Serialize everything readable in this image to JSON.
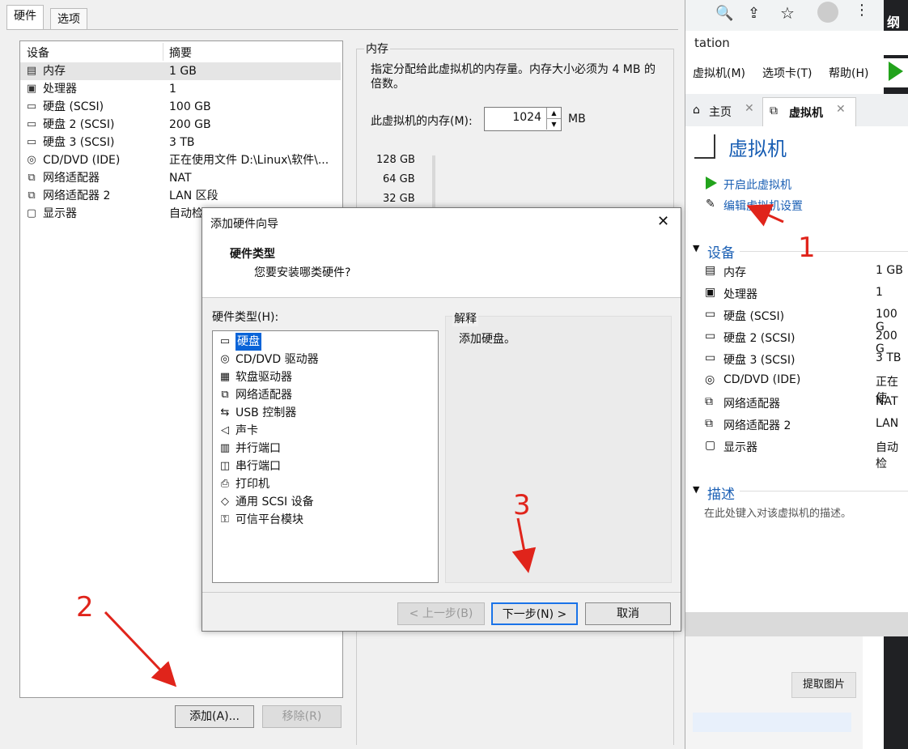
{
  "bg_window": {
    "title_fragment": "tation",
    "menu": [
      "虚拟机(M)",
      "选项卡(T)",
      "帮助(H)"
    ],
    "tabs": [
      {
        "label": "主页"
      },
      {
        "label": "虚拟机"
      }
    ],
    "vm_title": "虚拟机",
    "actions": [
      "开启此虚拟机",
      "编辑虚拟机设置"
    ],
    "devices_header": "设备",
    "devices": [
      {
        "name": "内存",
        "value": "1 GB"
      },
      {
        "name": "处理器",
        "value": "1"
      },
      {
        "name": "硬盘 (SCSI)",
        "value": "100 G"
      },
      {
        "name": "硬盘 2 (SCSI)",
        "value": "200 G"
      },
      {
        "name": "硬盘 3 (SCSI)",
        "value": "3 TB"
      },
      {
        "name": "CD/DVD (IDE)",
        "value": "正在使"
      },
      {
        "name": "网络适配器",
        "value": "NAT"
      },
      {
        "name": "网络适配器 2",
        "value": "LAN "
      },
      {
        "name": "显示器",
        "value": "自动检"
      }
    ],
    "desc_header": "描述",
    "desc_placeholder": "在此处键入对该虚拟机的描述。",
    "extract_button": "提取图片",
    "corner_text": "纲"
  },
  "settings": {
    "tabs": [
      "硬件",
      "选项"
    ],
    "columns": {
      "device": "设备",
      "summary": "摘要"
    },
    "devices": [
      {
        "icon": "memory-icon",
        "glyph": "▤",
        "name": "内存",
        "summary": "1 GB"
      },
      {
        "icon": "processor-icon",
        "glyph": "▣",
        "name": "处理器",
        "summary": "1"
      },
      {
        "icon": "harddisk-icon",
        "glyph": "▭",
        "name": "硬盘 (SCSI)",
        "summary": "100 GB"
      },
      {
        "icon": "harddisk-icon",
        "glyph": "▭",
        "name": "硬盘 2 (SCSI)",
        "summary": "200 GB"
      },
      {
        "icon": "harddisk-icon",
        "glyph": "▭",
        "name": "硬盘 3 (SCSI)",
        "summary": "3 TB"
      },
      {
        "icon": "cd-dvd-icon",
        "glyph": "◎",
        "name": "CD/DVD (IDE)",
        "summary": "正在使用文件 D:\\Linux\\软件\\..."
      },
      {
        "icon": "network-icon",
        "glyph": "⧉",
        "name": "网络适配器",
        "summary": "NAT"
      },
      {
        "icon": "network-icon",
        "glyph": "⧉",
        "name": "网络适配器 2",
        "summary": "LAN 区段"
      },
      {
        "icon": "display-icon",
        "glyph": "▢",
        "name": "显示器",
        "summary": "自动检"
      }
    ],
    "memory": {
      "group_label": "内存",
      "description": "指定分配给此虚拟机的内存量。内存大小必须为 4 MB 的倍数。",
      "field_label": "此虚拟机的内存(M):",
      "value": "1024",
      "unit": "MB",
      "ticks": [
        "128 GB",
        "64 GB",
        "32 GB"
      ]
    },
    "add_button": "添加(A)...",
    "remove_button": "移除(R)"
  },
  "wizard": {
    "title": "添加硬件向导",
    "heading": "硬件类型",
    "subheading": "您要安装哪类硬件?",
    "list_label": "硬件类型(H):",
    "items": [
      {
        "icon": "harddisk-icon",
        "glyph": "▭",
        "label": "硬盘",
        "selected": true
      },
      {
        "icon": "cd-dvd-icon",
        "glyph": "◎",
        "label": "CD/DVD 驱动器"
      },
      {
        "icon": "floppy-icon",
        "glyph": "▦",
        "label": "软盘驱动器"
      },
      {
        "icon": "network-icon",
        "glyph": "⧉",
        "label": "网络适配器"
      },
      {
        "icon": "usb-icon",
        "glyph": "⇆",
        "label": "USB 控制器"
      },
      {
        "icon": "sound-icon",
        "glyph": "◁",
        "label": "声卡"
      },
      {
        "icon": "parallel-port-icon",
        "glyph": "▥",
        "label": "并行端口"
      },
      {
        "icon": "serial-port-icon",
        "glyph": "◫",
        "label": "串行端口"
      },
      {
        "icon": "printer-icon",
        "glyph": "⎙",
        "label": "打印机"
      },
      {
        "icon": "scsi-icon",
        "glyph": "◇",
        "label": "通用 SCSI 设备"
      },
      {
        "icon": "tpm-icon",
        "glyph": "⚿",
        "label": "可信平台模块"
      }
    ],
    "explain_label": "解释",
    "explain_text": "添加硬盘。",
    "back_button": "< 上一步(B)",
    "next_button": "下一步(N) >",
    "cancel_button": "取消"
  },
  "annotations": [
    "1",
    "2",
    "3"
  ],
  "colors": {
    "selection": "#0a64d8",
    "annotation": "#e0241b",
    "link": "#1a5fb4",
    "play": "#22a31c"
  }
}
